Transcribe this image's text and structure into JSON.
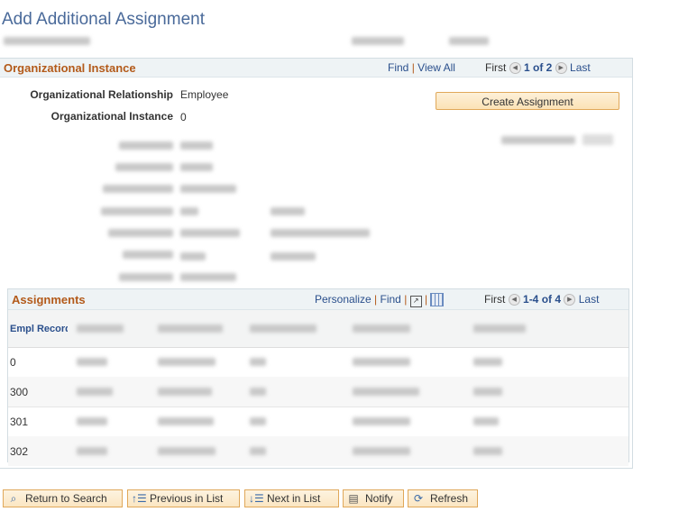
{
  "page_title": "Add Additional Assignment",
  "org_section": {
    "title": "Organizational Instance",
    "find": "Find",
    "view_all": "View All",
    "first": "First",
    "page": "1 of 2",
    "last": "Last",
    "fields": [
      {
        "label": "Organizational Relationship",
        "value": "Employee"
      },
      {
        "label": "Organizational Instance",
        "value": "0"
      }
    ],
    "create_button": "Create Assignment"
  },
  "assignments": {
    "title": "Assignments",
    "personalize": "Personalize",
    "find": "Find",
    "first": "First",
    "page": "1-4 of 4",
    "last": "Last",
    "col_header": "Empl Record",
    "rows": [
      "0",
      "300",
      "301",
      "302"
    ]
  },
  "buttons": {
    "return": "Return to Search",
    "previous": "Previous in List",
    "next": "Next in List",
    "notify": "Notify",
    "refresh": "Refresh"
  },
  "colors": {
    "accent": "#b35a1a",
    "link": "#2a4f8c",
    "button": "#fbe2b6"
  }
}
